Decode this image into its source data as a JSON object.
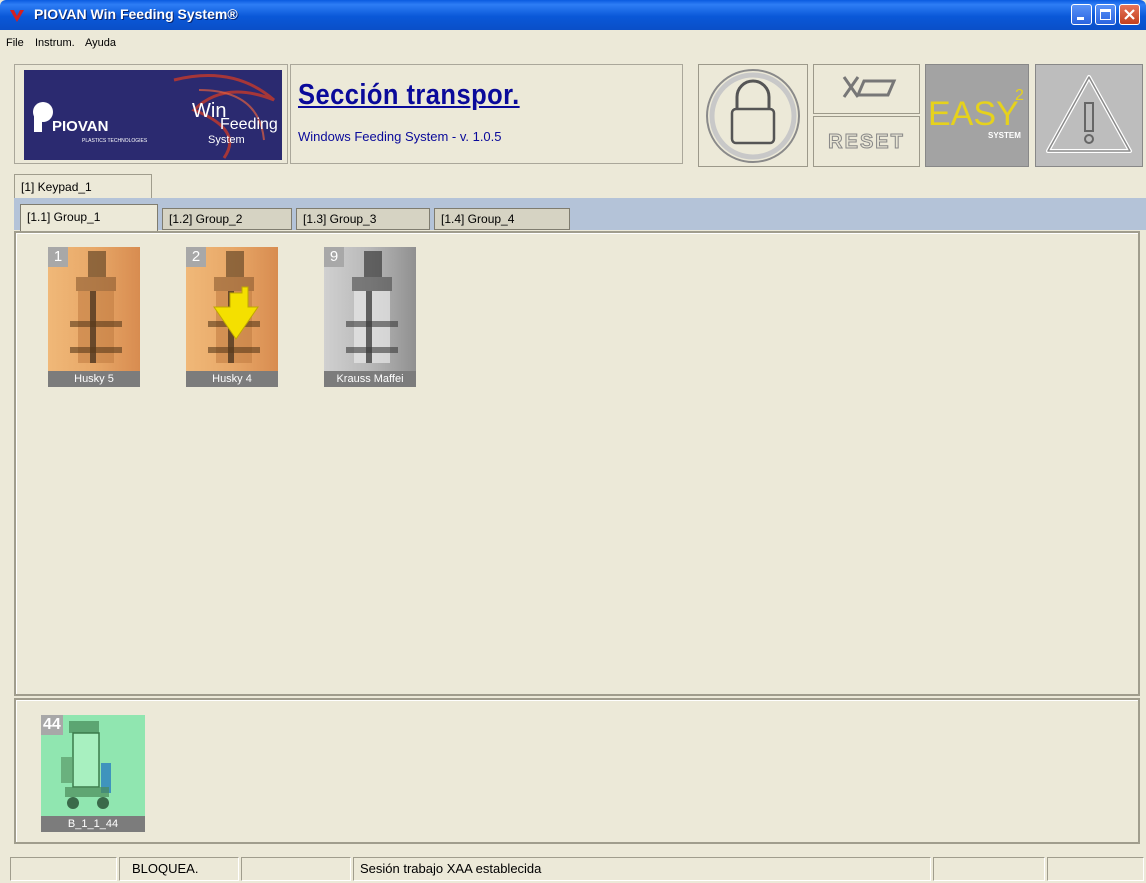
{
  "window": {
    "title": "PIOVAN Win Feeding System®"
  },
  "menu": [
    "File",
    "Instrum.",
    "Ayuda"
  ],
  "logo": {
    "brand": "PIOVAN",
    "brand_sub": "PLASTICS TECHNOLOGIES",
    "win": "Win",
    "feeding": "Feeding",
    "system": "System"
  },
  "section": {
    "title": "Sección transpor.",
    "subtitle": "Windows Feeding System - v. 1.0.5"
  },
  "buttons": {
    "reset": "RESET",
    "easy": "EASY",
    "easy_sup": "2",
    "easy_sub": "SYSTEM"
  },
  "keypad_tab": "[1] Keypad_1",
  "group_tabs": [
    "[1.1] Group_1",
    "[1.2] Group_2",
    "[1.3] Group_3",
    "[1.4] Group_4"
  ],
  "devices": [
    {
      "num": "1",
      "label": "Husky 5",
      "color": "#e8a868"
    },
    {
      "num": "2",
      "label": "Husky 4",
      "color": "#e8a868"
    },
    {
      "num": "9",
      "label": "Krauss Maffei",
      "color": "#b8b8b8"
    }
  ],
  "bottom_device": {
    "num": "44",
    "label": "B_1_1_44",
    "color": "#90e6b0"
  },
  "status": {
    "lock": "BLOQUEA.",
    "message": "Sesión trabajo XAA establecida"
  }
}
